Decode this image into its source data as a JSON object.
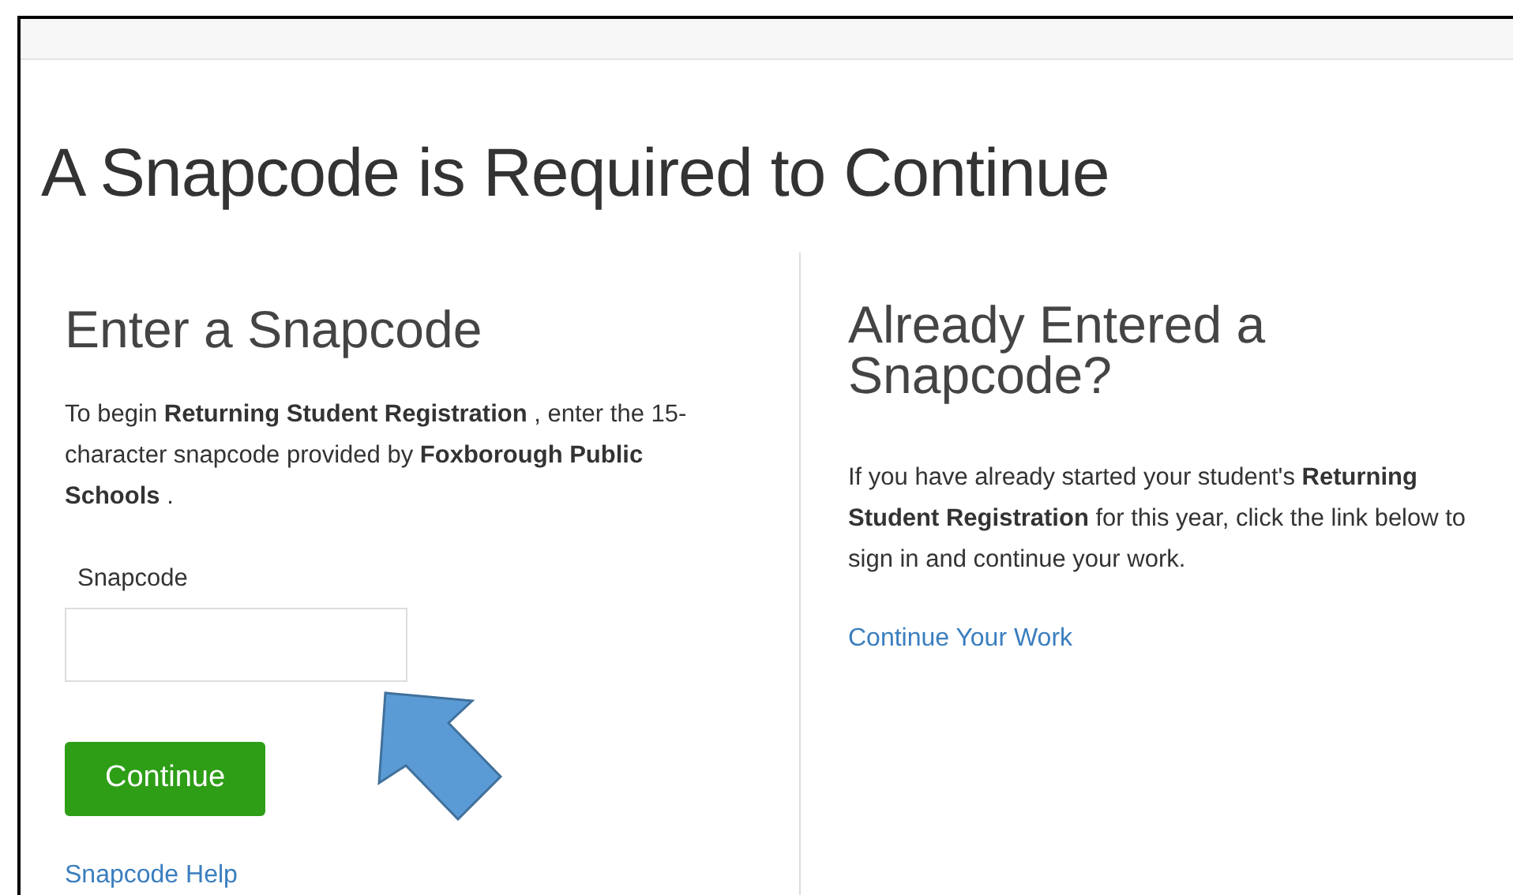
{
  "page_title": "A Snapcode is Required to Continue",
  "enter_section": {
    "heading": "Enter a Snapcode",
    "text": "To begin **Returning Student Registration** , enter the 15-character snapcode provided by **Foxborough Public Schools** .",
    "field_label": "Snapcode",
    "button": "Continue",
    "help_link": "Snapcode Help"
  },
  "existing_section": {
    "heading": "Already Entered a Snapcode?",
    "text": "If you have already started your student's **Returning Student Registration** for this year, click the link below to sign in and continue your work.",
    "link": "Continue Your Work"
  }
}
